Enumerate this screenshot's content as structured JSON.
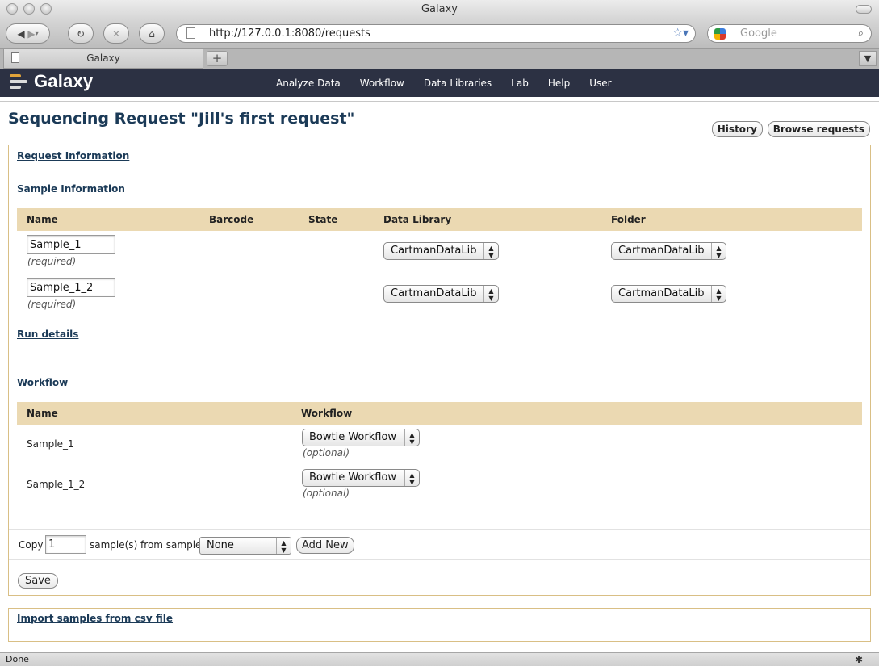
{
  "window": {
    "title": "Galaxy"
  },
  "browser": {
    "url": "http://127.0.0.1:8080/requests",
    "search_placeholder": "Google",
    "tab_title": "Galaxy",
    "new_tab": "+",
    "status": "Done"
  },
  "masthead": {
    "brand": "Galaxy",
    "nav": [
      "Analyze Data",
      "Workflow",
      "Data Libraries",
      "Lab",
      "Help",
      "User"
    ]
  },
  "page": {
    "title": "Sequencing Request \"Jill's first request\"",
    "history_button": "History",
    "browse_button": "Browse requests"
  },
  "request_info_link": "Request Information",
  "sample_info": {
    "heading": "Sample Information",
    "columns": [
      "Name",
      "Barcode",
      "State",
      "Data Library",
      "Folder"
    ],
    "rows": [
      {
        "name": "Sample_1",
        "hint": "(required)",
        "library": "CartmanDataLib",
        "folder": "CartmanDataLib"
      },
      {
        "name": "Sample_1_2",
        "hint": "(required)",
        "library": "CartmanDataLib",
        "folder": "CartmanDataLib"
      }
    ]
  },
  "run_details_link": "Run details",
  "workflow": {
    "link": "Workflow",
    "columns": [
      "Name",
      "Workflow"
    ],
    "rows": [
      {
        "name": "Sample_1",
        "workflow": "Bowtie Workflow",
        "hint": "(optional)"
      },
      {
        "name": "Sample_1_2",
        "workflow": "Bowtie Workflow",
        "hint": "(optional)"
      }
    ]
  },
  "copy": {
    "label": "Copy",
    "count": "1",
    "mid_label": "sample(s) from sample",
    "source": "None",
    "add_new": "Add New"
  },
  "save_button": "Save",
  "import_link": "Import samples from csv file"
}
